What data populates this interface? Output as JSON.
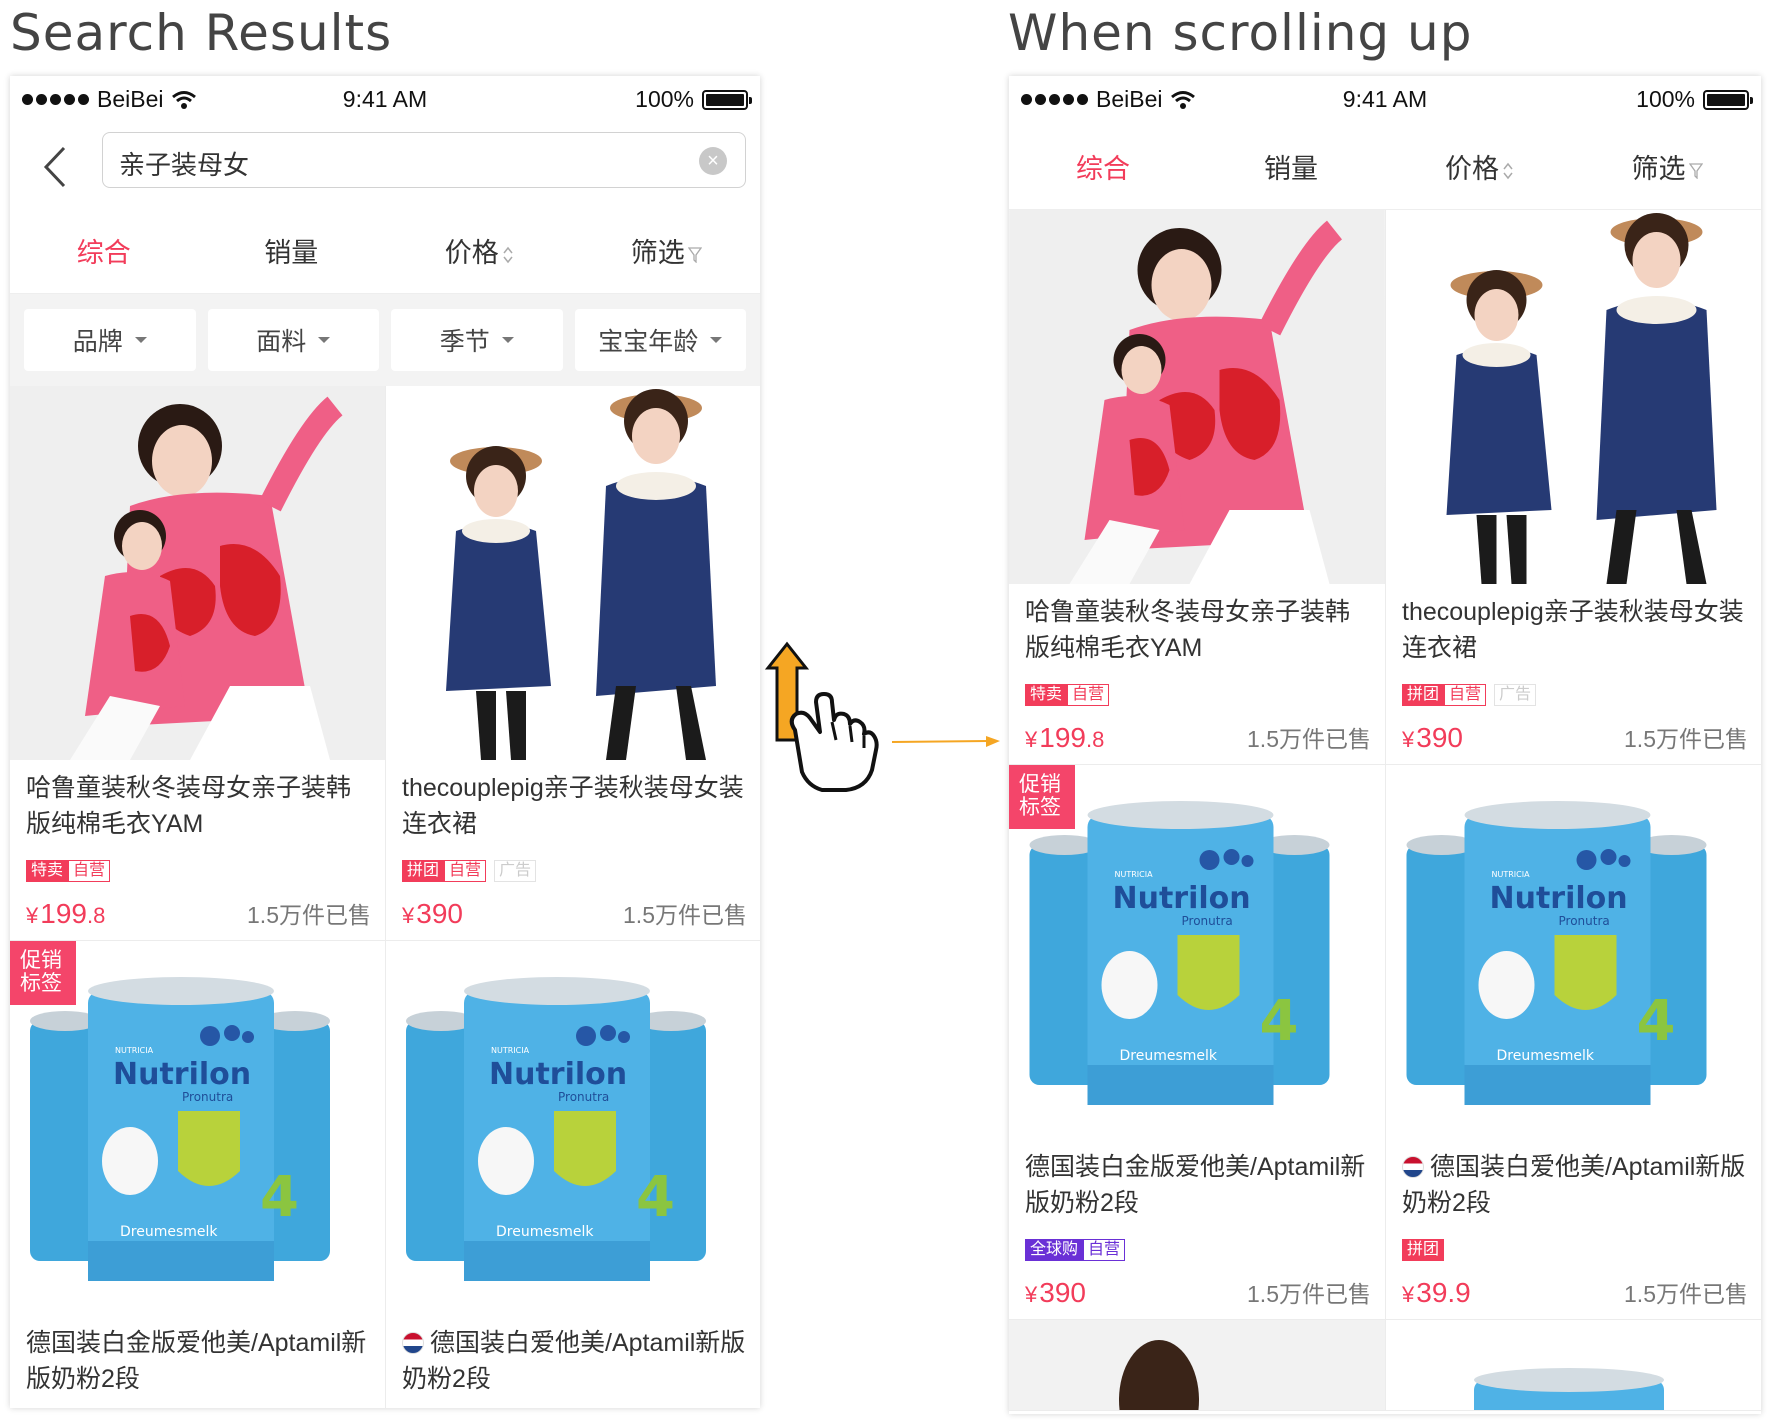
{
  "headings": {
    "left": "Search Results",
    "right": "When scrolling up"
  },
  "status": {
    "carrier": "BeiBei",
    "time": "9:41 AM",
    "battery": "100%"
  },
  "search": {
    "query": "亲子装母女"
  },
  "sort_tabs": [
    "综合",
    "销量",
    "价格",
    "筛选"
  ],
  "filter_chips": [
    "品牌",
    "面料",
    "季节",
    "宝宝年龄"
  ],
  "promo_badge": "促销\n标签",
  "products": [
    {
      "title": "哈鲁童装秋冬装母女亲子装韩版纯棉毛衣YAM",
      "tags": [
        "特卖",
        "自营"
      ],
      "price_int": "199",
      "price_dec": ".8",
      "sold": "1.5万件已售"
    },
    {
      "title": "thecouplepig亲子装秋装母女装连衣裙",
      "tags": [
        "拼团",
        "自营",
        "广告"
      ],
      "price_int": "390",
      "price_dec": "",
      "sold": "1.5万件已售"
    },
    {
      "title": "德国装白金版爱他美/Aptamil新版奶粉2段",
      "tags": [
        "全球购",
        "自营"
      ],
      "price_int": "390",
      "price_dec": "",
      "sold": "1.5万件已售"
    },
    {
      "title": "德国装白爱他美/Aptamil新版奶粉2段",
      "tags": [
        "拼团"
      ],
      "price_int": "39.9",
      "price_dec": "",
      "sold": "1.5万件已售"
    }
  ],
  "currency": "¥",
  "milk_brand": {
    "name": "Nutrilon",
    "sub": "Pronutra",
    "maker": "NUTRICIA",
    "variant": "Dreumesmelk",
    "stage": "4"
  },
  "colors": {
    "accent": "#f23c5a",
    "global_tag": "#6a30d6",
    "arrow": "#f5a623"
  }
}
